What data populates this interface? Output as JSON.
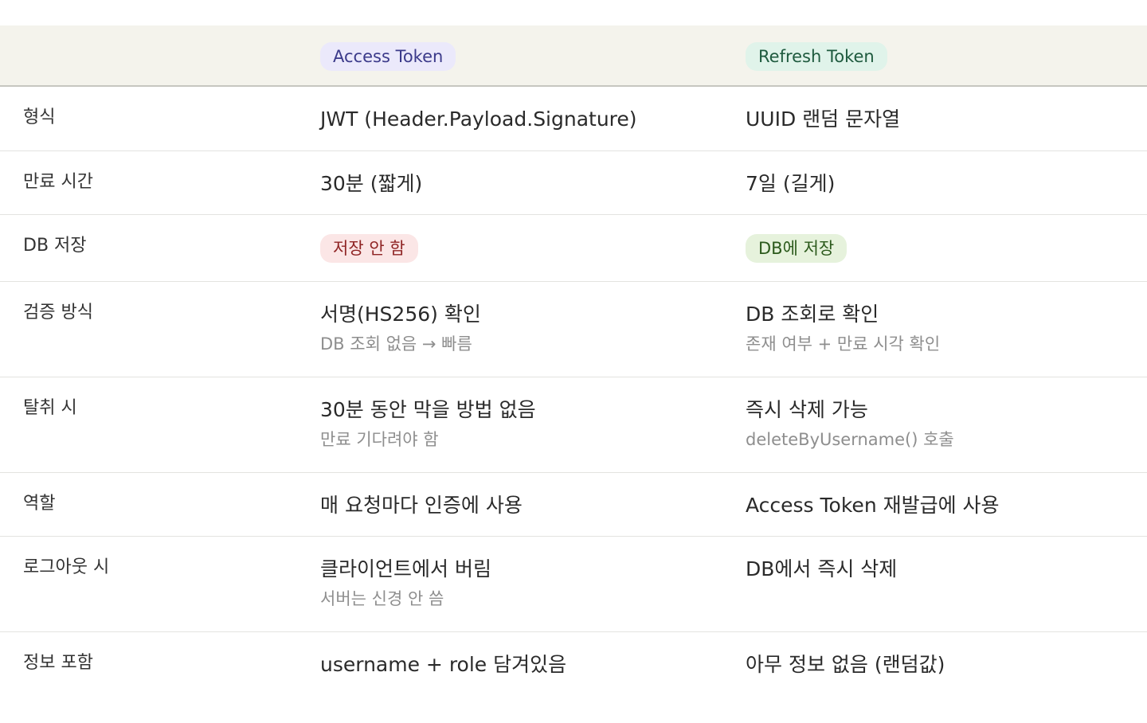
{
  "header": {
    "access_label": "Access Token",
    "refresh_label": "Refresh Token"
  },
  "rows": [
    {
      "label": "형식",
      "access_main": "JWT (Header.Payload.Signature)",
      "refresh_main": "UUID 랜덤 문자열"
    },
    {
      "label": "만료 시간",
      "access_main": "30분 (짧게)",
      "refresh_main": "7일 (길게)"
    },
    {
      "label": "DB 저장",
      "access_badge": "저장 안 함",
      "refresh_badge": "DB에 저장"
    },
    {
      "label": "검증 방식",
      "access_main": "서명(HS256) 확인",
      "access_sub": "DB 조회 없음 → 빠름",
      "refresh_main": "DB 조회로 확인",
      "refresh_sub": "존재 여부 + 만료 시각 확인"
    },
    {
      "label": "탈취 시",
      "access_main": "30분 동안 막을 방법 없음",
      "access_sub": "만료 기다려야 함",
      "refresh_main": "즉시 삭제 가능",
      "refresh_sub": "deleteByUsername() 호출"
    },
    {
      "label": "역할",
      "access_main": "매 요청마다 인증에 사용",
      "refresh_main": "Access Token 재발급에 사용"
    },
    {
      "label": "로그아웃 시",
      "access_main": "클라이언트에서 버림",
      "access_sub": "서버는 신경 안 씀",
      "refresh_main": "DB에서 즉시 삭제"
    },
    {
      "label": "정보 포함",
      "access_main": "username + role 담겨있음",
      "refresh_main": "아무 정보 없음 (랜덤값)"
    }
  ],
  "colors": {
    "header_bg": "#f4f3ec",
    "access_pill_bg": "#ebe9fb",
    "refresh_pill_bg": "#e0f3ea",
    "negative_badge_bg": "#fbe6e6",
    "positive_badge_bg": "#e6f2dc"
  }
}
